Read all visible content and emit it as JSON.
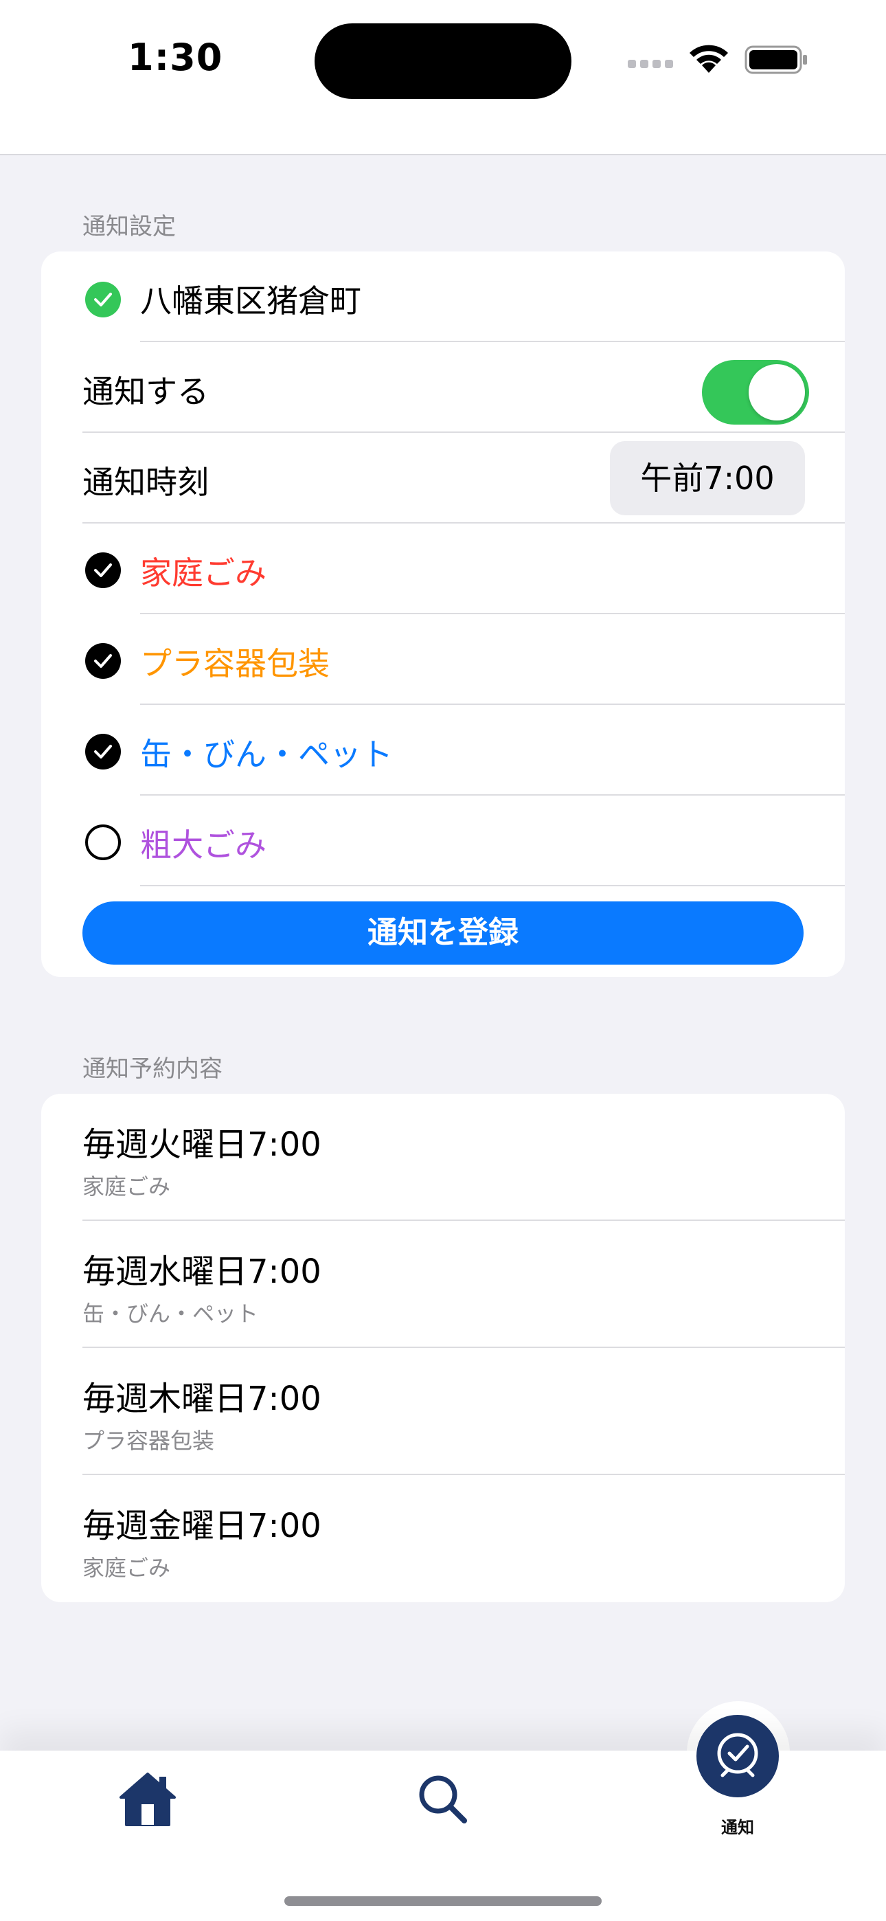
{
  "status_bar": {
    "time": "1:30"
  },
  "settings_section": {
    "header": "通知設定",
    "location": "八幡東区猪倉町",
    "notify_label": "通知する",
    "notify_on": true,
    "time_label": "通知時刻",
    "time_value": "午前7:00",
    "categories": [
      {
        "label": "家庭ごみ",
        "checked": true,
        "color": "#ff3b30"
      },
      {
        "label": "プラ容器包装",
        "checked": true,
        "color": "#ff9500"
      },
      {
        "label": "缶・びん・ペット",
        "checked": true,
        "color": "#0a7aff"
      },
      {
        "label": "粗大ごみ",
        "checked": false,
        "color": "#af52de"
      }
    ],
    "register_button": "通知を登録"
  },
  "schedule_section": {
    "header": "通知予約内容",
    "items": [
      {
        "title": "毎週火曜日7:00",
        "sub": "家庭ごみ"
      },
      {
        "title": "毎週水曜日7:00",
        "sub": "缶・びん・ペット"
      },
      {
        "title": "毎週木曜日7:00",
        "sub": "プラ容器包装"
      },
      {
        "title": "毎週金曜日7:00",
        "sub": "家庭ごみ"
      }
    ]
  },
  "tabbar": {
    "home_icon": "home-icon",
    "search_icon": "search-icon",
    "notify_icon": "clock-check-icon",
    "notify_label": "通知",
    "accent": "#1c3669"
  }
}
